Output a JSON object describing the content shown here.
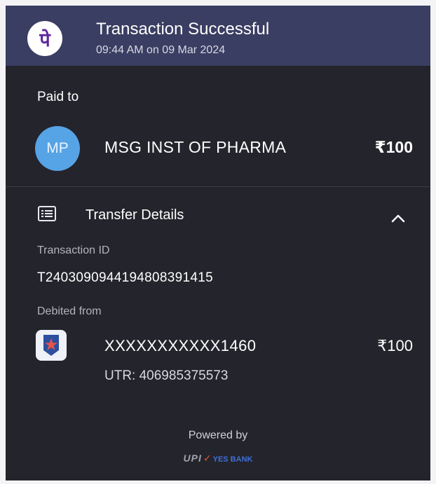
{
  "header": {
    "logo_glyph": "पे",
    "title": "Transaction Successful",
    "time": "09:44 AM on 09 Mar 2024",
    "background": "#3a3e62"
  },
  "paid_to": {
    "label": "Paid to",
    "avatar_initials": "MP",
    "avatar_color": "#56a3e5",
    "payee_name": "MSG INST OF PHARMA",
    "amount": "₹100"
  },
  "transfer_details": {
    "icon": "list-icon",
    "label": "Transfer Details",
    "toggle_icon": "chevron-up-icon",
    "expanded": true,
    "transaction_id_label": "Transaction ID",
    "transaction_id": "T2403090944194808391415",
    "debited_from_label": "Debited from",
    "bank_icon": "bank-icon",
    "account_masked": "XXXXXXXXXXX1460",
    "debited_amount": "₹100",
    "utr": "UTR: 406985375573"
  },
  "footer": {
    "powered_by": "Powered by",
    "upi_label": "UPI",
    "bank_name": "YES BANK"
  }
}
